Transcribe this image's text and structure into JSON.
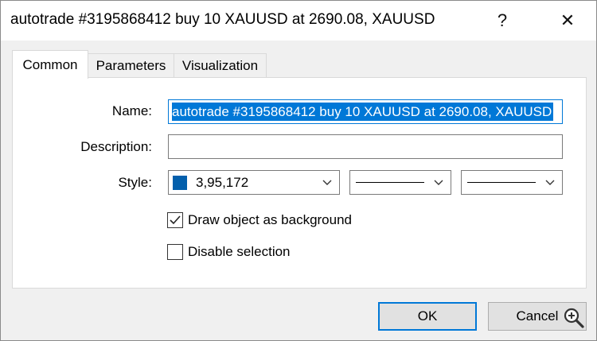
{
  "window": {
    "title": "autotrade #3195868412 buy 10 XAUUSD at 2690.08, XAUUSD",
    "help_label": "?",
    "close_label": "✕"
  },
  "tabs": [
    {
      "label": "Common",
      "active": true
    },
    {
      "label": "Parameters",
      "active": false
    },
    {
      "label": "Visualization",
      "active": false
    }
  ],
  "form": {
    "name_label": "Name:",
    "name_value": "autotrade #3195868412 buy 10 XAUUSD at 2690.08, XAUUSD",
    "description_label": "Description:",
    "description_value": "",
    "style_label": "Style:",
    "color_value": "3,95,172",
    "color_hex": "#035FAC",
    "draw_background_label": "Draw object as background",
    "draw_background_checked": true,
    "disable_selection_label": "Disable selection",
    "disable_selection_checked": false
  },
  "buttons": {
    "ok": "OK",
    "cancel": "Cancel"
  },
  "icons": {
    "help": "help-icon",
    "close": "close-icon",
    "chevron": "chevron-down-icon",
    "zoom": "zoom-in-icon"
  },
  "colors": {
    "accent": "#0078d7"
  }
}
